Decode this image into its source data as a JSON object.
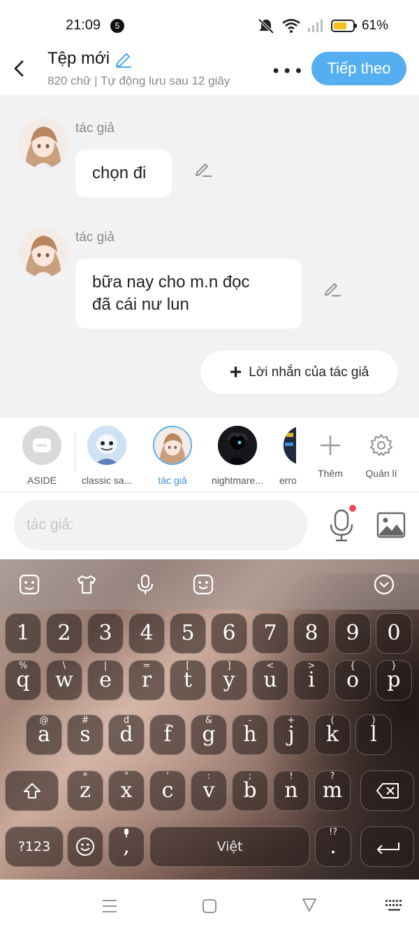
{
  "status_bar": {
    "time": "21:09",
    "notification_count": "5",
    "battery_pct": "61%"
  },
  "header": {
    "title": "Tệp mới",
    "subtitle": "820 chữ | Tự động lưu sau 12 giây",
    "next_label": "Tiếp theo"
  },
  "messages": [
    {
      "author": "tác giả",
      "text": "chọn đi"
    },
    {
      "author": "tác giả",
      "text_line1": "bữa nay cho m.n đọc",
      "text_line2": "đã cái nư lun"
    }
  ],
  "author_note_label": "Lời nhắn của tác giả",
  "characters": [
    {
      "label": "ASIDE"
    },
    {
      "label": "classic sa..."
    },
    {
      "label": "tác giả"
    },
    {
      "label": "nightmare..."
    },
    {
      "label": "erro"
    },
    {
      "label": "Thêm"
    },
    {
      "label": "Quản lí"
    }
  ],
  "input": {
    "placeholder": "tác giả:"
  },
  "keyboard": {
    "number_row": [
      "1",
      "2",
      "3",
      "4",
      "5",
      "6",
      "7",
      "8",
      "9",
      "0"
    ],
    "row1": [
      {
        "k": "q",
        "s": "%"
      },
      {
        "k": "w",
        "s": "\\"
      },
      {
        "k": "e",
        "s": "|"
      },
      {
        "k": "r",
        "s": "="
      },
      {
        "k": "t",
        "s": "["
      },
      {
        "k": "y",
        "s": "]"
      },
      {
        "k": "u",
        "s": "<"
      },
      {
        "k": "i",
        "s": ">"
      },
      {
        "k": "o",
        "s": "{"
      },
      {
        "k": "p",
        "s": "}"
      }
    ],
    "row2": [
      {
        "k": "a",
        "s": "@"
      },
      {
        "k": "s",
        "s": "#"
      },
      {
        "k": "d",
        "s": "đ"
      },
      {
        "k": "f",
        "s": "_"
      },
      {
        "k": "g",
        "s": "&"
      },
      {
        "k": "h",
        "s": "-"
      },
      {
        "k": "j",
        "s": "+"
      },
      {
        "k": "k",
        "s": "("
      },
      {
        "k": "l",
        "s": ")"
      }
    ],
    "row3": [
      {
        "k": "z",
        "s": "*"
      },
      {
        "k": "x",
        "s": "\""
      },
      {
        "k": "c",
        "s": "'"
      },
      {
        "k": "v",
        "s": ":"
      },
      {
        "k": "b",
        "s": ";"
      },
      {
        "k": "n",
        "s": "!"
      },
      {
        "k": "m",
        "s": "?"
      }
    ],
    "symbols_label": "?123",
    "comma": ",",
    "space_label": "Việt",
    "period": ".",
    "period_sub": "!?"
  },
  "colors": {
    "accent": "#55aef0",
    "selected_label": "#3b8fe0",
    "mic_dot": "#f0475c"
  }
}
